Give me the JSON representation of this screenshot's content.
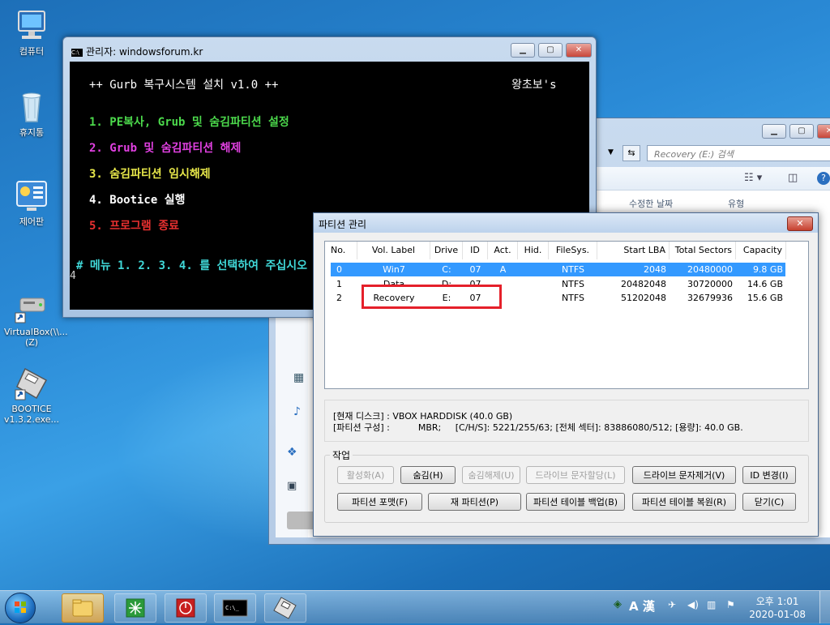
{
  "desktop": {
    "icons": [
      {
        "label": "컴퓨터"
      },
      {
        "label": "휴지통"
      },
      {
        "label": "제어판"
      },
      {
        "label": "VirtualBox(\\\\...\n(Z)"
      },
      {
        "label": "BOOTICE\nv1.3.2.exe..."
      }
    ]
  },
  "cmd": {
    "title": "관리자:  windowsforum.kr",
    "header": "++ Gurb 복구시스템 설치 v1.0 ++",
    "author": "왕초보's",
    "menu": [
      {
        "text": "1. PE복사, Grub 및 숨김파티션 설정",
        "color": "#4cd94c"
      },
      {
        "text": "2. Grub 및 숨김파티션 해제",
        "color": "#e040e0"
      },
      {
        "text": "3. 숨김파티션 임시해제",
        "color": "#e8e84a"
      },
      {
        "text": "4. Bootice 실행",
        "color": "#ffffff"
      },
      {
        "text": "5. 프로그램 종료",
        "color": "#e83030"
      }
    ],
    "prompt": "# 메뉴 1. 2. 3. 4. 를 선택하여 주십시오",
    "input": "4"
  },
  "explorer": {
    "search_placeholder": "Recovery (E:) 검색",
    "col_modified": "수정한 날짜",
    "col_type": "유형"
  },
  "dialog": {
    "title": "파티션 관리",
    "columns": [
      "No.",
      "Vol. Label",
      "Drive",
      "ID",
      "Act.",
      "Hid.",
      "FileSys.",
      "Start LBA",
      "Total Sectors",
      "Capacity"
    ],
    "rows": [
      {
        "no": "0",
        "label": "Win7",
        "drive": "C:",
        "id": "07",
        "act": "A",
        "hid": "",
        "fs": "NTFS",
        "start": "2048",
        "total": "20480000",
        "cap": "9.8 GB",
        "selected": true
      },
      {
        "no": "1",
        "label": "Data",
        "drive": "D:",
        "id": "07",
        "act": "",
        "hid": "",
        "fs": "NTFS",
        "start": "20482048",
        "total": "30720000",
        "cap": "14.6 GB",
        "selected": false
      },
      {
        "no": "2",
        "label": "Recovery",
        "drive": "E:",
        "id": "07",
        "act": "",
        "hid": "",
        "fs": "NTFS",
        "start": "51202048",
        "total": "32679936",
        "cap": "15.6 GB",
        "selected": false
      }
    ],
    "disk_line": "[현재 디스크] : VBOX HARDDISK (40.0 GB)",
    "layout_line": "[파티션 구성] :          MBR;     [C/H/S]: 5221/255/63; [전체 섹터]: 83886080/512; [용량]: 40.0 GB.",
    "group_label": "작업",
    "buttons_row1": [
      {
        "label": "활성화(A)",
        "disabled": true
      },
      {
        "label": "숨김(H)",
        "disabled": false
      },
      {
        "label": "숨김해제(U)",
        "disabled": true
      },
      {
        "label": "드라이브 문자할당(L)",
        "disabled": true
      },
      {
        "label": "드라이브 문자제거(V)",
        "disabled": false
      },
      {
        "label": "ID 변경(I)",
        "disabled": false
      }
    ],
    "buttons_row2": [
      {
        "label": "파티션 포맷(F)"
      },
      {
        "label": "재 파티션(P)"
      },
      {
        "label": "파티션 테이블 백업(B)"
      },
      {
        "label": "파티션 테이블 복원(R)"
      },
      {
        "label": "닫기(C)"
      }
    ]
  },
  "taskbar": {
    "ime": "A 漢",
    "time": "오후 1:01",
    "date": "2020-01-08"
  }
}
